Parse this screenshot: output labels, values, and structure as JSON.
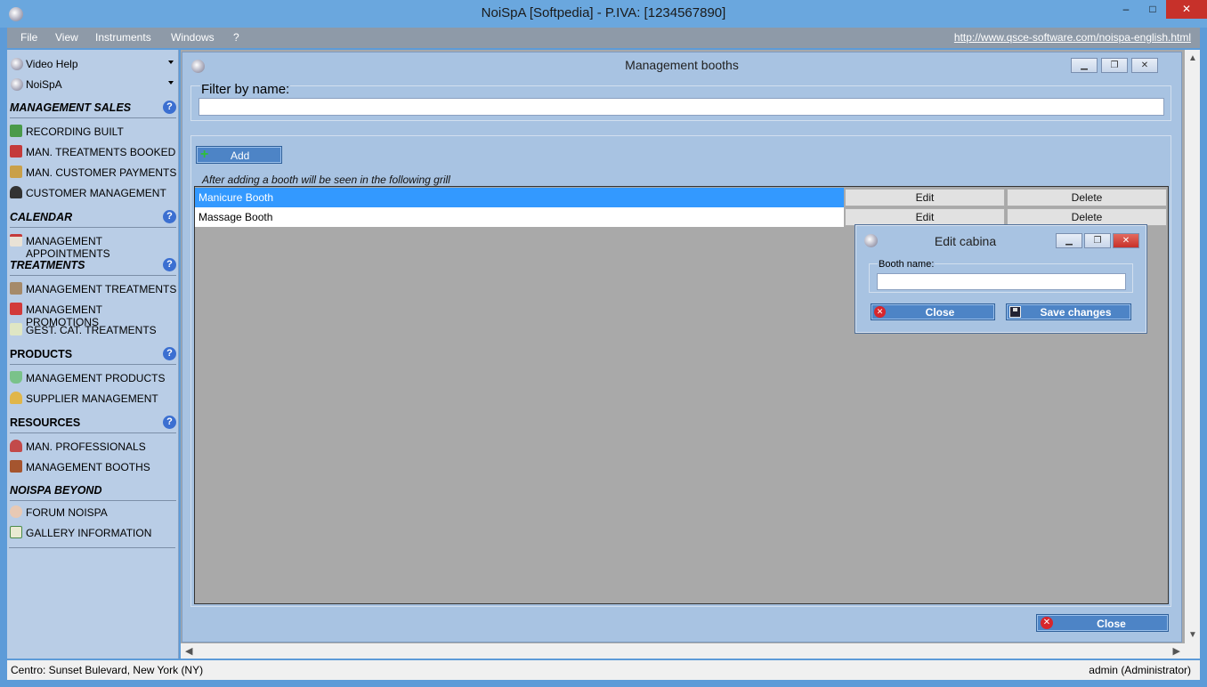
{
  "window": {
    "title": "NoiSpA  [Softpedia] - P.IVA: [1234567890]",
    "min_label": "‒",
    "max_label": "□",
    "close_label": "✕"
  },
  "menu": {
    "items": [
      "File",
      "View",
      "Instruments",
      "Windows",
      "?"
    ],
    "url": "http://www.qsce-software.com/noispa-english.html"
  },
  "sidebar": {
    "dropdowns": [
      "Video Help",
      "NoiSpA"
    ],
    "help_label": "?",
    "sections": [
      {
        "title": "MANAGEMENT SALES",
        "items": [
          "RECORDING BUILT",
          "MAN. TREATMENTS BOOKED",
          "MAN. CUSTOMER PAYMENTS",
          "CUSTOMER MANAGEMENT"
        ]
      },
      {
        "title": "CALENDAR",
        "items": [
          "MANAGEMENT APPOINTMENTS"
        ]
      },
      {
        "title": "TREATMENTS",
        "items": [
          "MANAGEMENT TREATMENTS",
          "MANAGEMENT PROMOTIONS",
          "GEST. CAT. TREATMENTS"
        ]
      },
      {
        "title": "PRODUCTS",
        "items": [
          "MANAGEMENT PRODUCTS",
          "SUPPLIER MANAGEMENT"
        ]
      },
      {
        "title": "RESOURCES",
        "items": [
          "MAN. PROFESSIONALS",
          "MANAGEMENT BOOTHS"
        ]
      },
      {
        "title": "NOISPA BEYOND",
        "items": [
          "FORUM NOISPA",
          "GALLERY INFORMATION"
        ]
      }
    ]
  },
  "booths_window": {
    "title": "Management booths",
    "filter_label": "Filter by name:",
    "filter_value": "",
    "add_label": "Add",
    "hint": "After adding a booth will be seen in the following grill",
    "rows": [
      {
        "name": "Manicure Booth",
        "edit": "Edit",
        "delete": "Delete"
      },
      {
        "name": "Massage Booth",
        "edit": "Edit",
        "delete": "Delete"
      }
    ],
    "close_label": "Close"
  },
  "edit_dialog": {
    "title": "Edit cabina",
    "field_label": "Booth name:",
    "field_value": "",
    "close_label": "Close",
    "save_label": "Save changes"
  },
  "status": {
    "left": "Centro: Sunset Bulevard,  New York (NY)",
    "right": "admin (Administrator)"
  },
  "colors": {
    "accent": "#4d84c6",
    "selection": "#3399ff",
    "panel": "#a8c3e2",
    "sidebar": "#b9cde6",
    "titlebar": "#6aa7de"
  }
}
